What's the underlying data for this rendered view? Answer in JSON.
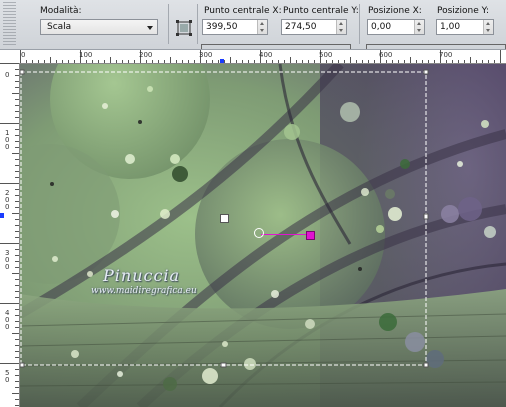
{
  "toolbar": {
    "mode_label": "Modalità:",
    "mode_value": "Scala",
    "center_x_label": "Punto centrale X:",
    "center_x_value": "399,50",
    "center_y_label": "Punto centrale Y:",
    "center_y_value": "274,50",
    "pos_x_label": "Posizione X:",
    "pos_x_value": "0,00",
    "pos_y_label": "Posizione Y:",
    "pos_y_value": "1,00"
  },
  "ruler_h": [
    "0",
    "100",
    "200",
    "300",
    "400",
    "500",
    "600",
    "700"
  ],
  "ruler_v": [
    "0",
    "1\n0\n0",
    "2\n0\n0",
    "3\n0\n0",
    "4\n0\n0",
    "5\n0"
  ],
  "watermark": {
    "name": "Pinuccia",
    "site": "www.maidiregrafica.eu"
  },
  "colors": {
    "accent": "#e014d0",
    "selection_marker": "#1a3cff",
    "canvas_green": "#8fb57f",
    "canvas_purple": "#5e4f73"
  },
  "icons": {
    "tool": "pick-tool-icon",
    "dropdown": "chevron-down-icon"
  }
}
